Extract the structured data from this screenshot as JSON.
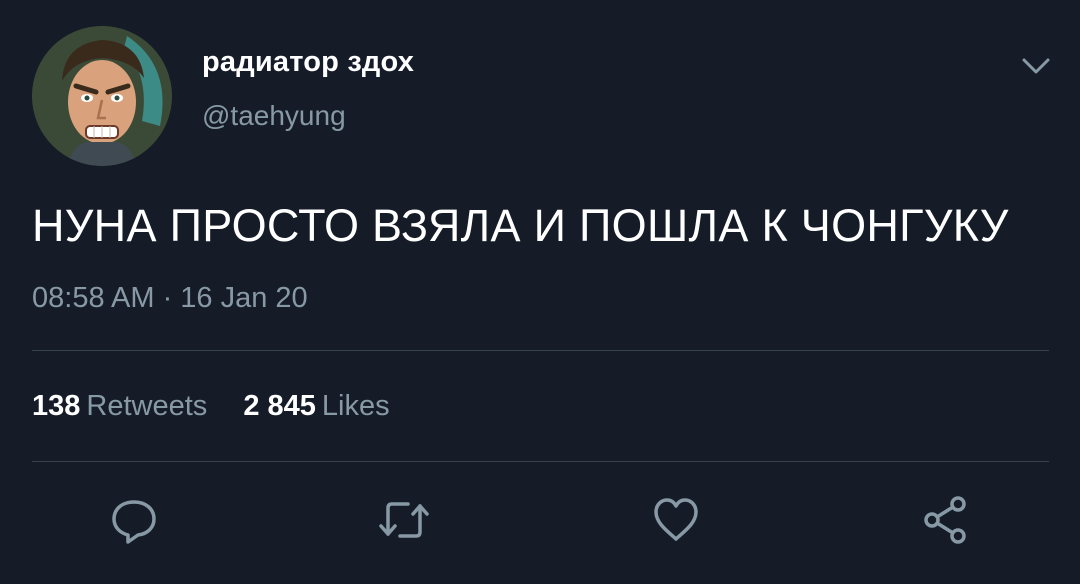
{
  "user": {
    "display_name": "радиатор здох",
    "handle": "@taehyung"
  },
  "tweet": {
    "text": "НУНА ПРОСТО ВЗЯЛА И ПОШЛА К ЧОНГУКУ",
    "timestamp": "08:58 AM · 16 Jan 20"
  },
  "stats": {
    "retweets_count": "138",
    "retweets_label": "Retweets",
    "likes_count": "2 845",
    "likes_label": "Likes"
  },
  "icons": {
    "more": "chevron-down-icon",
    "reply": "speech-bubble-icon",
    "retweet": "retweet-arrows-icon",
    "like": "heart-icon",
    "share": "share-nodes-icon"
  },
  "colors": {
    "background": "#151c28",
    "primary_text": "#ffffff",
    "secondary_text": "#8899a6",
    "divider": "#38444d"
  }
}
